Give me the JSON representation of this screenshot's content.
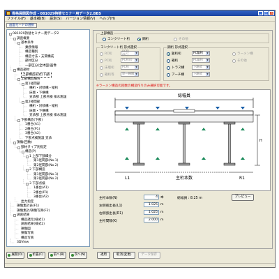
{
  "window": {
    "title": "骨格展開図作成 - 081029持替セミナー用データ2.BBS",
    "controls": [
      "_",
      "□",
      "×"
    ]
  },
  "menu": [
    "ファイル(F)",
    "基本補(B)",
    "設定(S)",
    "バージョン情報(V)",
    "ヘルプ(H)"
  ],
  "toolbar": {
    "mode_label": "画面モードの選択"
  },
  "tree": {
    "items": [
      {
        "label": "081029持替セミナー用データ2",
        "depth": 0,
        "twisty": "-"
      },
      {
        "label": "調査概要",
        "depth": 1,
        "twisty": "-"
      },
      {
        "label": "基本条件",
        "depth": 2,
        "twisty": "-"
      },
      {
        "label": "業務情報",
        "depth": 3,
        "twisty": ""
      },
      {
        "label": "構造種別",
        "depth": 3,
        "twisty": ""
      },
      {
        "label": "構造寸法・支間構成",
        "depth": 3,
        "twisty": ""
      },
      {
        "label": "部材区分",
        "depth": 3,
        "twisty": ""
      },
      {
        "label": "一部区分(全体図)画像",
        "depth": 3,
        "twisty": ""
      },
      {
        "label": "構造部材",
        "depth": 1,
        "twisty": "-"
      },
      {
        "label": "上部構造形式(下部)",
        "depth": 2,
        "twisty": "",
        "selected": true
      },
      {
        "label": "上部構造細分",
        "depth": 2,
        "twisty": "-"
      },
      {
        "label": "第1径間部",
        "depth": 3,
        "twisty": "-"
      },
      {
        "label": "横桁・対傾構・縦桁",
        "depth": 4,
        "twisty": ""
      },
      {
        "label": "床版・下横構",
        "depth": 4,
        "twisty": ""
      },
      {
        "label": "支承部 上部点検 排水施設",
        "depth": 4,
        "twisty": ""
      },
      {
        "label": "第2径間部",
        "depth": 3,
        "twisty": "-"
      },
      {
        "label": "横桁・対傾構・縦桁",
        "depth": 4,
        "twisty": ""
      },
      {
        "label": "床版・下横構",
        "depth": 4,
        "twisty": ""
      },
      {
        "label": "支承部 上部点検 排水施設",
        "depth": 4,
        "twisty": ""
      },
      {
        "label": "下部構造(下部)",
        "depth": 2,
        "twisty": "-"
      },
      {
        "label": "1番台(A1)",
        "depth": 3,
        "twisty": ""
      },
      {
        "label": "2番台(P1)",
        "depth": 3,
        "twisty": ""
      },
      {
        "label": "3番台(A2)",
        "depth": 3,
        "twisty": ""
      },
      {
        "label": "下部点検施設 支承",
        "depth": 3,
        "twisty": ""
      },
      {
        "label": "損傷(回数)",
        "depth": 1,
        "twisty": "-"
      },
      {
        "label": "部材タイプ別指定",
        "depth": 2,
        "twisty": "-"
      },
      {
        "label": "構造(P)",
        "depth": 3,
        "twisty": "-"
      },
      {
        "label": "1 上部下部細分",
        "depth": 4,
        "twisty": "-"
      },
      {
        "label": "第1径間部(No.1)",
        "depth": 5,
        "twisty": ""
      },
      {
        "label": "第2径間部(No.2)",
        "depth": 5,
        "twisty": ""
      },
      {
        "label": "2 下部構造",
        "depth": 4,
        "twisty": "-"
      },
      {
        "label": "第1径間部(No.1)",
        "depth": 5,
        "twisty": ""
      },
      {
        "label": "第2径間部(No.2)",
        "depth": 5,
        "twisty": ""
      },
      {
        "label": "3 下部点検",
        "depth": 4,
        "twisty": "-"
      },
      {
        "label": "1番台(A1)",
        "depth": 5,
        "twisty": ""
      },
      {
        "label": "2番台(P1)",
        "depth": 5,
        "twisty": ""
      },
      {
        "label": "3番台(A2)",
        "depth": 5,
        "twisty": ""
      },
      {
        "label": "出力指定",
        "depth": 2,
        "twisty": ""
      },
      {
        "label": "損傷集計表(F1)",
        "depth": 1,
        "twisty": ""
      },
      {
        "label": "損傷集計/損傷写真(F2)",
        "depth": 1,
        "twisty": ""
      },
      {
        "label": "調査結果",
        "depth": 1,
        "twisty": "-"
      },
      {
        "label": "構造諸元(様式1)",
        "depth": 2,
        "twisty": ""
      },
      {
        "label": "調査結果(様式2)",
        "depth": 2,
        "twisty": ""
      },
      {
        "label": "損傷図",
        "depth": 2,
        "twisty": ""
      },
      {
        "label": "損傷写真",
        "depth": 2,
        "twisty": ""
      },
      {
        "label": "構造写真",
        "depth": 2,
        "twisty": ""
      },
      {
        "label": "3DView",
        "depth": 1,
        "twisty": ""
      }
    ],
    "buttons": [
      "展開(O)",
      "折畳(C)",
      "前へ(B)",
      "次へ(N)"
    ]
  },
  "form": {
    "upper_structure": {
      "title": "上部構造",
      "options": [
        "コンクリート桁",
        "鋼桁",
        "その他"
      ],
      "selected": 1
    },
    "concrete_form": {
      "title": "コンクリート桁 形式選択",
      "rows": [
        {
          "label": "RC桁",
          "select": "RC桁(RC)"
        },
        {
          "label": "PC桁",
          "select": "PC桁(I)"
        },
        {
          "label": "床版桁",
          "select": "PC桁"
        },
        {
          "label": "箱桁等",
          "select": "単一種類"
        }
      ]
    },
    "steel_form": {
      "title": "鋼桁 形式選択",
      "rows": [
        {
          "label": "鈑桁桁",
          "select": "PC鈑桁",
          "extra": "ラーメン構",
          "selected": true
        },
        {
          "label": "箱桁",
          "select": "PC鈑桁",
          "extra": "その他"
        },
        {
          "label": "トラス構",
          "select": "下路式",
          "extra": ""
        },
        {
          "label": "アーチ構",
          "select": "下路式",
          "extra": ""
        }
      ]
    },
    "warning": "※ラーメン構造の回数の構造作りのみ選択可能です。",
    "diagram": {
      "width_label": "総幅員",
      "main_girder_label": "主桁本数",
      "left_label": "L1",
      "right_label": "R1",
      "height_label": "H"
    },
    "fields": [
      {
        "label": "主桁本数(N)",
        "value": "4",
        "unit": "本"
      },
      {
        "label": "左側張出長(L1)",
        "value": "1.025",
        "unit": "m"
      },
      {
        "label": "右側張出長(R1)",
        "value": "1.025",
        "unit": "m"
      },
      {
        "label": "主桁間隔(K)",
        "value": "2.000",
        "unit": "m"
      }
    ],
    "total_width": "総幅員 : 8.25 m",
    "preview_label": "プレビュー"
  },
  "bottom_buttons": {
    "apply": "適用",
    "cancel": "取消(変更)",
    "save_label": "データ保存"
  },
  "colors": {
    "warning": "#e01010",
    "girder": "#1a5fa8",
    "titlebar": "#2f63c8"
  }
}
